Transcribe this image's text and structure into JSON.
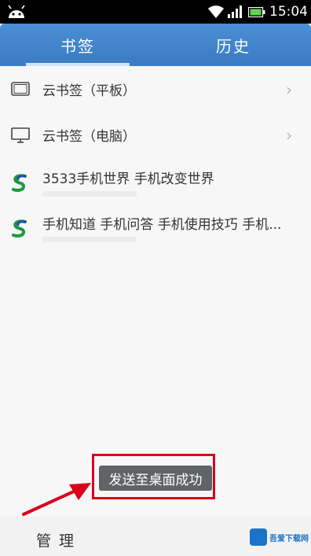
{
  "status_bar": {
    "time": "15:04"
  },
  "tabs": [
    {
      "label": "书签",
      "active": true
    },
    {
      "label": "历史",
      "active": false
    }
  ],
  "bookmarks": [
    {
      "label": "云书签（平板）",
      "icon": "tablet-icon",
      "has_chevron": true
    },
    {
      "label": "云书签（电脑）",
      "icon": "monitor-icon",
      "has_chevron": true
    },
    {
      "label": "3533手机世界 手机改变世界",
      "icon": "site-favicon-icon"
    },
    {
      "label": "手机知道 手机问答 手机使用技巧 手机...",
      "icon": "site-favicon-icon"
    }
  ],
  "toast": {
    "text": "发送至桌面成功"
  },
  "bottom_bar": {
    "manage_label": "管理"
  },
  "watermark": {
    "text": "吾爱下载网"
  },
  "colors": {
    "tab_bar": "#3a7bc3",
    "annotation": "#d9001b",
    "toast_bg": "#5f6468"
  }
}
